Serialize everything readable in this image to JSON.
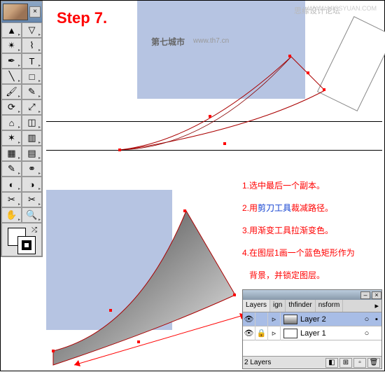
{
  "step_label": "Step 7.",
  "watermarks": {
    "w1": "思缘设计论坛",
    "w1b": "WWW.MISSYUAN.COM",
    "w2": "第七城市",
    "w2b": "www.th7.cn"
  },
  "instructions": [
    {
      "num": "1.",
      "pre": "选中最后一个副本。"
    },
    {
      "num": "2.",
      "pre": "用",
      "blue": "剪刀工具",
      "post": "裁减路径。"
    },
    {
      "num": "3.",
      "pre": "用渐变工具拉渐变色。"
    },
    {
      "num": "4.",
      "pre": "在图层1画一个蓝色矩形作为",
      "post2": "背景，并锁定图层。"
    }
  ],
  "layers_panel": {
    "tabs": [
      "Layers",
      "ign",
      "thfinder",
      "nsform"
    ],
    "rows": [
      {
        "name": "Layer 2",
        "selected": true,
        "mark": "○"
      },
      {
        "name": "Layer 1",
        "selected": false,
        "mark": "○",
        "locked": true
      }
    ],
    "footer_label": "2 Layers"
  },
  "tool_names": [
    "selection",
    "direct-select",
    "magic-wand",
    "lasso",
    "pen",
    "type",
    "line",
    "rectangle",
    "paintbrush",
    "pencil",
    "rotate",
    "scale",
    "warp",
    "free-transform",
    "symbol-spray",
    "graph",
    "mesh",
    "gradient",
    "eyedropper",
    "blend",
    "live-paint",
    "live-select",
    "slice",
    "scissors",
    "hand",
    "zoom"
  ],
  "tool_glyphs": [
    "▲",
    "▽",
    "✴",
    "⌇",
    "✒",
    "T",
    "╲",
    "□",
    "🖌",
    "✎",
    "⟳",
    "⤢",
    "⌂",
    "◫",
    "✶",
    "▥",
    "▦",
    "▤",
    "✎",
    "⚭",
    "◐",
    "◑",
    "✂",
    "✂",
    "✋",
    "🔍"
  ]
}
